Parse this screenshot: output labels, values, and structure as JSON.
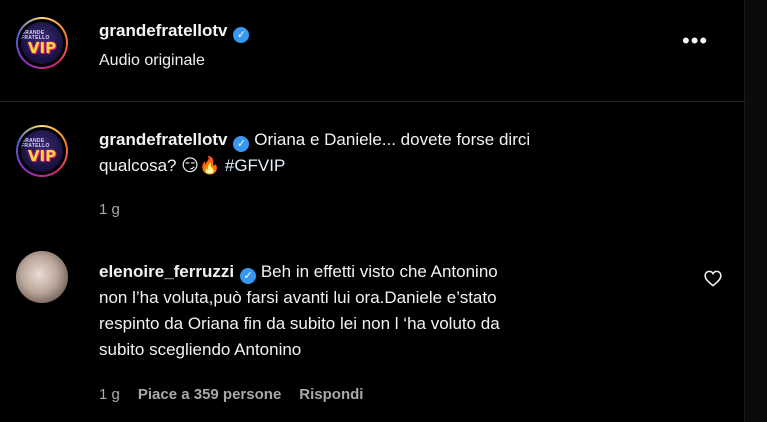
{
  "header": {
    "username": "grandefratellotv",
    "subtitle": "Audio originale",
    "more_icon": "more-options-icon",
    "avatar_logo": {
      "small_text": "GRANDE FRATELLO",
      "big_text": "VIP"
    }
  },
  "caption": {
    "username": "grandefratellotv",
    "text_line1": "Oriana e Daniele... dovete forse dirci",
    "text_line2": "qualcosa? 😏🔥",
    "hashtag": "#GFVIP",
    "time": "1 g"
  },
  "comment": {
    "username": "elenoire_ferruzzi",
    "line1": "Beh in effetti visto che Antonino",
    "line2": "non l’ha voluta,può farsi avanti lui ora.Daniele e’stato",
    "line3": "respinto da Oriana fin da subito lei non l ‘ha voluto da",
    "line4": "subito scegliendo Antonino",
    "time": "1 g",
    "likes": "Piace a 359 persone",
    "reply": "Rispondi",
    "like_icon": "heart-icon"
  },
  "colors": {
    "background": "#000000",
    "verified": "#3897f0",
    "muted": "#a8a8a8"
  }
}
